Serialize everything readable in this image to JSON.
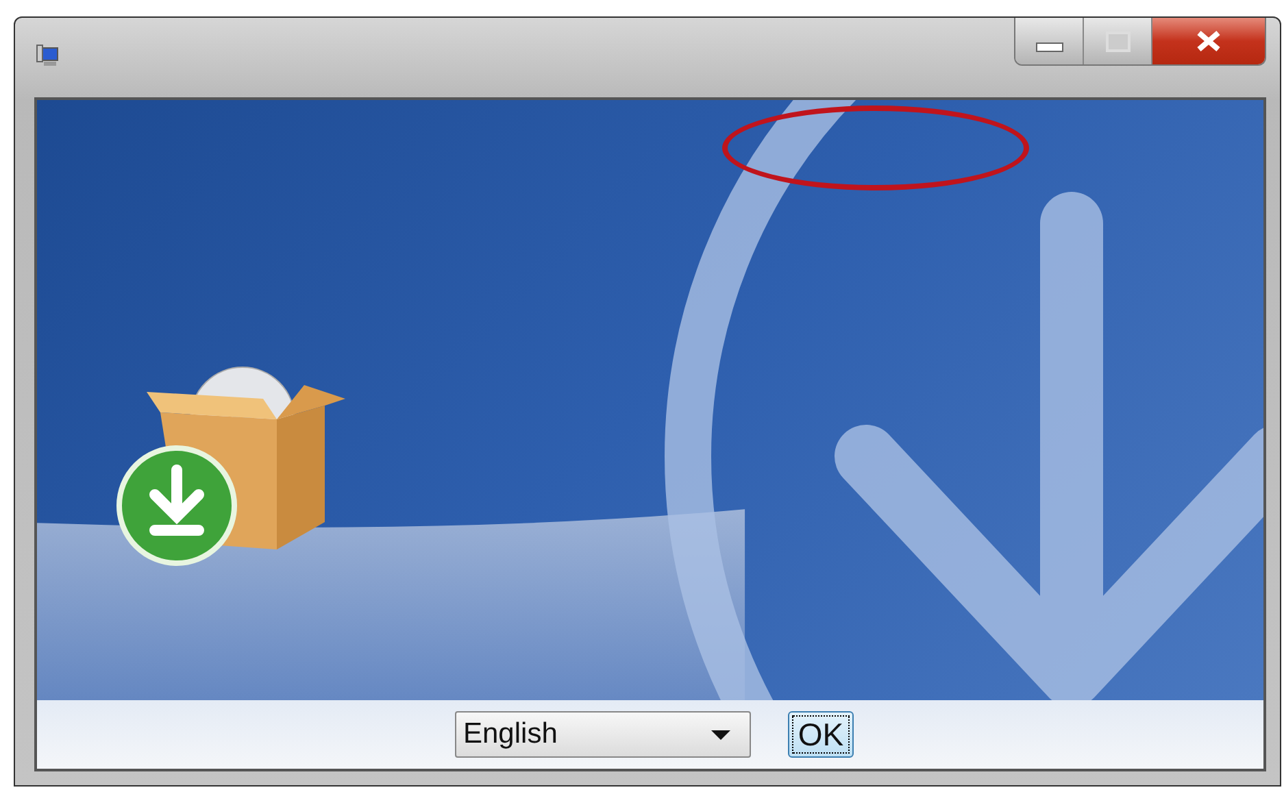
{
  "window": {
    "highlight_ellipse": true
  },
  "language_select": {
    "value": "English"
  },
  "ok_button": {
    "label": "OK",
    "focused": true
  }
}
